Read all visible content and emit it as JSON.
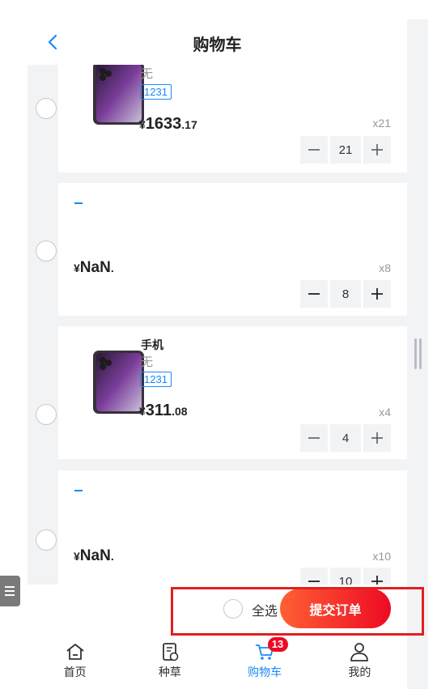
{
  "navbar": {
    "title": "购物车",
    "back_icon": "chevron-left-icon"
  },
  "items": [
    {
      "has_product": true,
      "name": "",
      "spec": "无",
      "tag": "1231",
      "price_currency": "¥",
      "price_int": "1633",
      "price_dec": ".17",
      "qty_label": "x21",
      "stepper_value": "21"
    },
    {
      "has_product": false,
      "price_currency": "¥",
      "price_int": "NaN",
      "price_dec": ".",
      "qty_label": "x8",
      "stepper_value": "8"
    },
    {
      "has_product": true,
      "name": "手机",
      "spec": "无",
      "tag": "1231",
      "price_currency": "¥",
      "price_int": "311",
      "price_dec": ".08",
      "qty_label": "x4",
      "stepper_value": "4"
    },
    {
      "has_product": false,
      "price_currency": "¥",
      "price_int": "NaN",
      "price_dec": ".",
      "qty_label": "x10",
      "stepper_value": "10"
    }
  ],
  "submit_bar": {
    "select_all_label": "全选",
    "submit_label": "提交订单"
  },
  "tabbar": [
    {
      "label": "首页",
      "icon": "home-icon",
      "active": false
    },
    {
      "label": "种草",
      "icon": "note-icon",
      "active": false
    },
    {
      "label": "购物车",
      "icon": "cart-icon",
      "active": true,
      "badge": "13"
    },
    {
      "label": "我的",
      "icon": "user-icon",
      "active": false
    }
  ],
  "colors": {
    "accent": "#1989fa",
    "submit_gradient_start": "#ff6034",
    "submit_gradient_end": "#ee0a24",
    "highlight": "#e02020",
    "badge": "#ee0a24"
  }
}
